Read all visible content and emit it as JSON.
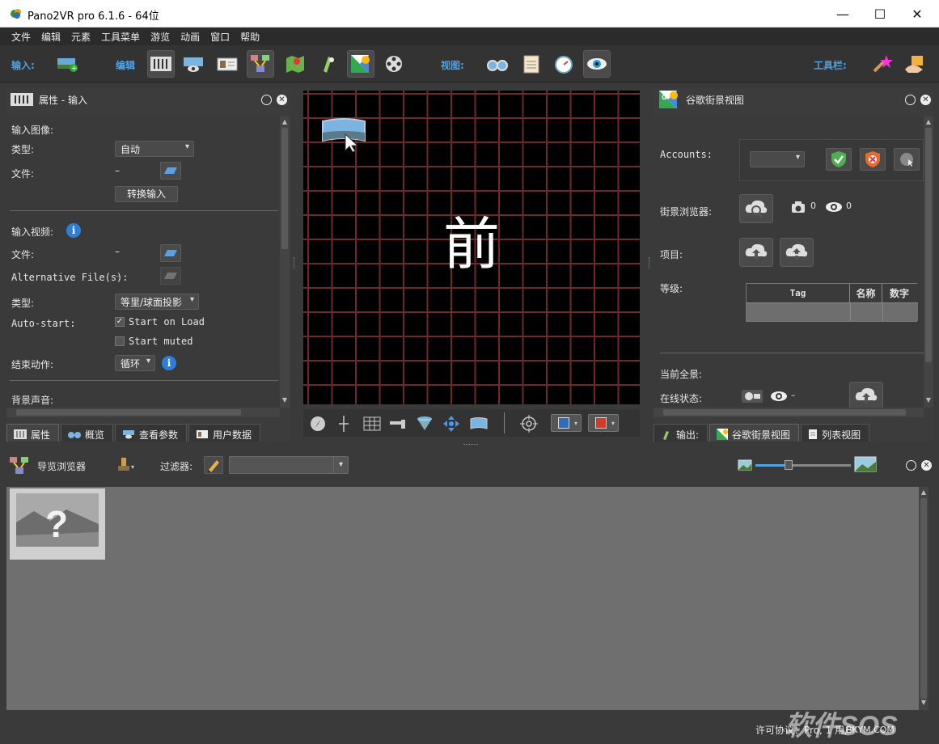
{
  "window": {
    "title": "Pano2VR pro 6.1.6 - 64位"
  },
  "menu": [
    "文件",
    "编辑",
    "元素",
    "工具菜单",
    "游览",
    "动画",
    "窗口",
    "帮助"
  ],
  "toolbar": {
    "input_label": "输入:",
    "edit_label": "编辑",
    "view_label": "视图:",
    "tools_label": "工具栏:"
  },
  "properties": {
    "title": "属性 - 输入",
    "input_image_heading": "输入图像:",
    "type_label": "类型:",
    "type_value": "自动",
    "file_label": "文件:",
    "file_value": "–",
    "convert_button": "转换输入",
    "input_video_heading": "输入视频:",
    "video_file_label": "文件:",
    "video_file_value": "–",
    "alt_file_label": "Alternative File(s):",
    "alt_file_value": "–",
    "video_type_label": "类型:",
    "video_type_value": "等里/球面投影",
    "autostart_label": "Auto-start:",
    "start_on_load": "Start on Load",
    "start_muted": "Start muted",
    "end_action_label": "结束动作:",
    "end_action_value": "循环",
    "bg_sound_heading": "背景声音:"
  },
  "left_tabs": [
    "属性",
    "概览",
    "查看参数",
    "用户数据"
  ],
  "viewport": {
    "face_label": "前"
  },
  "streetview": {
    "title": "谷歌街景视图",
    "accounts_label": "Accounts:",
    "browser_label": "街景浏览器:",
    "photo_count": "0",
    "view_count": "0",
    "project_label": "项目:",
    "level_label": "等级:",
    "table_headers": [
      "Tag",
      "名称",
      "数字"
    ],
    "current_pano_label": "当前全景:",
    "online_status_label": "在线状态:",
    "online_status_value": "–"
  },
  "right_tabs": [
    "输出:",
    "谷歌街景视图",
    "列表视图"
  ],
  "tour_browser": {
    "title": "导览浏览器",
    "filter_label": "过滤器:"
  },
  "status": {
    "license": "许可协议：Pro, 1 用户",
    "watermark": "软件SOS",
    "watermark_sub": "BKYM.COM"
  },
  "colors": {
    "accent_blue": "#4da3e8",
    "grid_red": "#6e2a2a",
    "bg_dark": "#3a3a3a"
  }
}
